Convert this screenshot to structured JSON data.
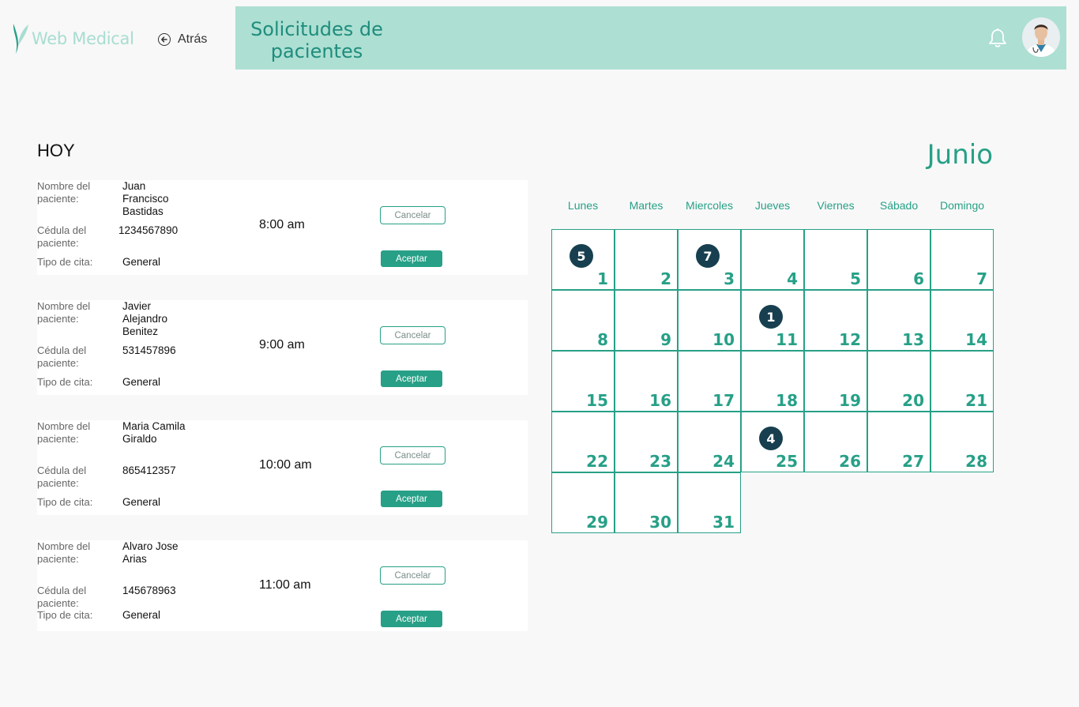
{
  "header": {
    "logo_text": "Web Medical",
    "back_label": "Atrás",
    "title": "Solicitudes de pacientes",
    "bar_color": "#addfd3",
    "accent_color": "#27a087"
  },
  "today_section": {
    "title": "HOY",
    "labels": {
      "name": "Nombre del paciente:",
      "id": "Cédula del paciente:",
      "type": "Tipo de cita:"
    },
    "cancel_label": "Cancelar",
    "accept_label": "Aceptar",
    "appointments": [
      {
        "name": "Juan Francisco Bastidas",
        "id": "1234567890",
        "type": "General",
        "time": "8:00 am"
      },
      {
        "name": "Javier Alejandro Benitez",
        "id": "531457896",
        "type": "General",
        "time": "9:00 am"
      },
      {
        "name": "Maria Camila Giraldo",
        "id": "865412357",
        "type": "General",
        "time": "10:00 am"
      },
      {
        "name": "Alvaro Jose Arias",
        "id": "145678963",
        "type": "General",
        "time": "11:00 am"
      }
    ]
  },
  "calendar": {
    "month": "Junio",
    "weekdays": [
      "Lunes",
      "Martes",
      "Miercoles",
      "Jueves",
      "Viernes",
      "Sábado",
      "Domingo"
    ],
    "days": [
      "1",
      "2",
      "3",
      "4",
      "5",
      "6",
      "7",
      "8",
      "9",
      "10",
      "11",
      "12",
      "13",
      "14",
      "15",
      "16",
      "17",
      "18",
      "19",
      "20",
      "21",
      "22",
      "23",
      "24",
      "25",
      "26",
      "27",
      "28",
      "29",
      "30",
      "31"
    ],
    "badges": {
      "1": "5",
      "3": "7",
      "11": "1",
      "25": "4"
    },
    "badge_color": "#173f4f"
  }
}
